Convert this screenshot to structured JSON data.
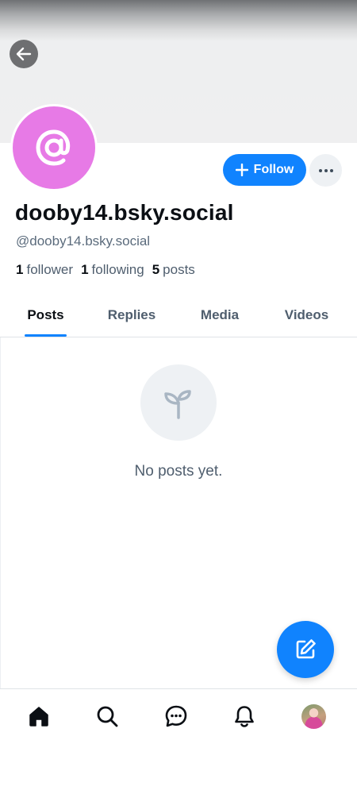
{
  "profile": {
    "display_name": "dooby14.bsky.social",
    "handle": "@dooby14.bsky.social",
    "avatar_color": "#e77ae6",
    "avatar_symbol": "@"
  },
  "actions": {
    "follow_label": "Follow",
    "more_icon": "ellipsis-icon"
  },
  "stats": {
    "followers_count": "1",
    "followers_label": "follower",
    "following_count": "1",
    "following_label": "following",
    "posts_count": "5",
    "posts_label": "posts"
  },
  "tabs": [
    {
      "label": "Posts",
      "active": true
    },
    {
      "label": "Replies",
      "active": false
    },
    {
      "label": "Media",
      "active": false
    },
    {
      "label": "Videos",
      "active": false
    }
  ],
  "feed": {
    "empty_icon": "sprout-icon",
    "empty_message": "No posts yet."
  },
  "bottom_nav": [
    "home-icon",
    "search-icon",
    "chat-icon",
    "bell-icon",
    "profile-avatar"
  ],
  "colors": {
    "accent": "#1083fe",
    "muted_text": "#4f5e6e",
    "chip_bg": "#eef1f4"
  }
}
